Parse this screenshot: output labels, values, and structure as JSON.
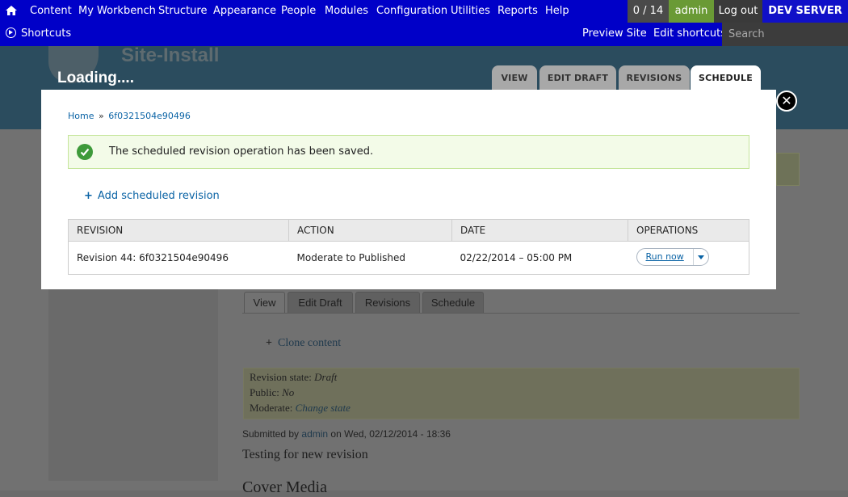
{
  "toolbar": {
    "menu": [
      "Content",
      "My Workbench",
      "Structure",
      "Appearance",
      "People",
      "Modules",
      "Configuration",
      "Utilities",
      "Reports",
      "Help"
    ],
    "counter": "0 / 14",
    "user": "admin",
    "logout": "Log out",
    "environment": "DEV SERVER",
    "shortcuts": "Shortcuts",
    "preview_site": "Preview Site",
    "edit_shortcuts": "Edit shortcuts",
    "search_placeholder": "Search"
  },
  "header": {
    "site_name": "Site-Install",
    "loading": "Loading....",
    "tabs": [
      "VIEW",
      "EDIT DRAFT",
      "REVISIONS",
      "SCHEDULE"
    ],
    "active_tab": "SCHEDULE"
  },
  "modal": {
    "breadcrumb": {
      "home": "Home",
      "separator": "»",
      "current": "6f0321504e90496"
    },
    "status_message": "The scheduled revision operation has been saved.",
    "add_link": "Add scheduled revision",
    "table": {
      "headers": [
        "REVISION",
        "ACTION",
        "DATE",
        "OPERATIONS"
      ],
      "rows": [
        {
          "revision": "Revision 44: 6f0321504e90496",
          "action": "Moderate to Published",
          "date": "02/22/2014 – 05:00 PM",
          "operation": "Run now"
        }
      ]
    },
    "close_symbol": "✕"
  },
  "background": {
    "secondary_tabs": [
      "View",
      "Edit Draft",
      "Revisions",
      "Schedule"
    ],
    "clone_link": "Clone content",
    "revision_state_label": "Revision state:",
    "revision_state_value": "Draft",
    "public_label": "Public:",
    "public_value": "No",
    "moderate_label": "Moderate:",
    "moderate_link": "Change state",
    "submitted_prefix": "Submitted by",
    "submitted_user": "admin",
    "submitted_suffix": "on Wed, 02/12/2014 - 18:36",
    "body_text": "Testing for new revision",
    "cover_heading": "Cover Media"
  },
  "colors": {
    "toolbar": "#0000c8",
    "user_badge": "#6a9a35",
    "link": "#0a63a5",
    "status_bg": "#f3fbe8"
  }
}
